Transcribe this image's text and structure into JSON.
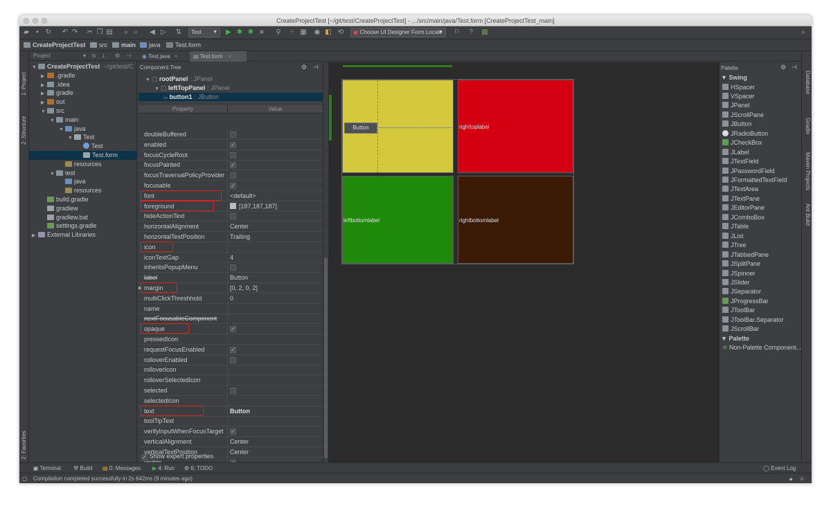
{
  "window": {
    "title": "CreateProjectTest [~/git/test/CreateProjectTest] - .../src/main/java/Test.form [CreateProjectTest_main]"
  },
  "toolbar": {
    "run_config": "Test",
    "locale_combo": "Choose UI Designer Form Locale"
  },
  "navbar": {
    "crumbs": [
      "CreateProjectTest",
      "src",
      "main",
      "java",
      "Test.form"
    ]
  },
  "left_strip": {
    "project": "1: Project",
    "structure": "2: Structure",
    "favorites": "2: Favorites"
  },
  "right_strip": {
    "database": "Database",
    "gradle": "Gradle",
    "maven": "Maven Projects",
    "ant": "Ant Build"
  },
  "project_panel": {
    "header": "Project",
    "items": [
      {
        "label": "CreateProjectTest",
        "suffix": "~/git/test/C",
        "depth": 0,
        "arrow": "▼",
        "icon": "folder-icon"
      },
      {
        "label": ".gradle",
        "depth": 1,
        "arrow": "▶",
        "icon": "folder-icon"
      },
      {
        "label": ".idea",
        "depth": 1,
        "arrow": "▶",
        "icon": "folder-icon"
      },
      {
        "label": "gradle",
        "depth": 1,
        "arrow": "▶",
        "icon": "folder-icon"
      },
      {
        "label": "out",
        "depth": 1,
        "arrow": "▶",
        "icon": "folder-icon"
      },
      {
        "label": "src",
        "depth": 1,
        "arrow": "▼",
        "icon": "folder-icon"
      },
      {
        "label": "main",
        "depth": 2,
        "arrow": "▼",
        "icon": "folder-icon"
      },
      {
        "label": "java",
        "depth": 3,
        "arrow": "▼",
        "icon": "folder-icon"
      },
      {
        "label": "Test",
        "depth": 4,
        "arrow": "▼",
        "icon": "form-icon"
      },
      {
        "label": "Test",
        "depth": 5,
        "arrow": "",
        "icon": "class-icon"
      },
      {
        "label": "Test.form",
        "depth": 5,
        "arrow": "",
        "icon": "form-icon"
      },
      {
        "label": "resources",
        "depth": 3,
        "arrow": "",
        "icon": "folder-icon"
      },
      {
        "label": "test",
        "depth": 2,
        "arrow": "▼",
        "icon": "folder-icon"
      },
      {
        "label": "java",
        "depth": 3,
        "arrow": "",
        "icon": "folder-icon"
      },
      {
        "label": "resources",
        "depth": 3,
        "arrow": "",
        "icon": "folder-icon"
      },
      {
        "label": "build.gradle",
        "depth": 1,
        "arrow": "",
        "icon": "gradle-icon"
      },
      {
        "label": "gradlew",
        "depth": 1,
        "arrow": "",
        "icon": "file-icon"
      },
      {
        "label": "gradlew.bat",
        "depth": 1,
        "arrow": "",
        "icon": "file-icon"
      },
      {
        "label": "settings.gradle",
        "depth": 1,
        "arrow": "",
        "icon": "gradle-icon"
      },
      {
        "label": "External Libraries",
        "depth": 0,
        "arrow": "▶",
        "icon": "library-icon"
      }
    ]
  },
  "editor_tabs": [
    "Test.java",
    "Test.form"
  ],
  "component_tree": {
    "header": "Component Tree",
    "nodes": [
      {
        "name": "rootPanel",
        "type": ": JPanel",
        "depth": 0
      },
      {
        "name": "leftTopPanel",
        "type": ": JPanel",
        "depth": 1
      },
      {
        "name": "button1",
        "type": ": JButton",
        "depth": 2
      }
    ]
  },
  "properties": {
    "header_property": "Property",
    "header_value": "Value",
    "footer_checkbox": "Show expert properties",
    "rows": [
      {
        "name": "doubleBuffered",
        "type": "check",
        "checked": false
      },
      {
        "name": "enabled",
        "type": "check",
        "checked": true
      },
      {
        "name": "focusCycleRoot",
        "type": "check",
        "checked": false
      },
      {
        "name": "focusPainted",
        "type": "check",
        "checked": true
      },
      {
        "name": "focusTraversalPolicyProvider",
        "type": "check",
        "checked": false
      },
      {
        "name": "focusable",
        "type": "check",
        "checked": true
      },
      {
        "name": "font",
        "type": "text",
        "value": "<default>",
        "highlight": true
      },
      {
        "name": "foreground",
        "type": "color",
        "value": "[187,187,187]",
        "highlight": true
      },
      {
        "name": "hideActionText",
        "type": "check",
        "checked": false
      },
      {
        "name": "horizontalAlignment",
        "type": "text",
        "value": "Center"
      },
      {
        "name": "horizontalTextPosition",
        "type": "text",
        "value": "Trailing"
      },
      {
        "name": "icon",
        "type": "text",
        "value": "",
        "highlight": true
      },
      {
        "name": "iconTextGap",
        "type": "text",
        "value": "4"
      },
      {
        "name": "inheritsPopupMenu",
        "type": "check",
        "checked": false
      },
      {
        "name": "label",
        "type": "text",
        "value": "Button",
        "strike": true
      },
      {
        "name": "margin",
        "type": "text",
        "value": "[0, 2, 0, 2]",
        "highlight": true,
        "expand": true
      },
      {
        "name": "multiClickThreshhold",
        "type": "text",
        "value": "0"
      },
      {
        "name": "name",
        "type": "text",
        "value": ""
      },
      {
        "name": "nextFocusableComponent",
        "type": "text",
        "value": "",
        "strike": true
      },
      {
        "name": "opaque",
        "type": "check",
        "checked": true,
        "highlight": true
      },
      {
        "name": "pressedIcon",
        "type": "text",
        "value": ""
      },
      {
        "name": "requestFocusEnabled",
        "type": "check",
        "checked": true
      },
      {
        "name": "rolloverEnabled",
        "type": "check",
        "checked": false
      },
      {
        "name": "rolloverIcon",
        "type": "text",
        "value": ""
      },
      {
        "name": "rolloverSelectedIcon",
        "type": "text",
        "value": ""
      },
      {
        "name": "selected",
        "type": "check",
        "checked": false
      },
      {
        "name": "selectedIcon",
        "type": "text",
        "value": ""
      },
      {
        "name": "text",
        "type": "text",
        "value": "Button",
        "highlight": true,
        "bold": true
      },
      {
        "name": "toolTipText",
        "type": "text",
        "value": ""
      },
      {
        "name": "verifyInputWhenFocusTarget",
        "type": "check",
        "checked": true
      },
      {
        "name": "verticalAlignment",
        "type": "text",
        "value": "Center"
      },
      {
        "name": "verticalTextPosition",
        "type": "text",
        "value": "Center"
      },
      {
        "name": "visible",
        "type": "check",
        "checked": true
      }
    ]
  },
  "designer": {
    "button_label": "Button",
    "righttop_label": "righttoplabel",
    "leftbottom_label": "leftbottomlabel",
    "rightbottom_label": "rightbottomlabel",
    "colors": {
      "lefttop": "#d4c93c",
      "righttop": "#d40012",
      "leftbottom": "#1f8a0a",
      "rightbottom": "#3a1a05"
    }
  },
  "palette": {
    "header": "Palette",
    "group_swing": "Swing",
    "group_palette": "Palette",
    "swing_items": [
      "HSpacer",
      "VSpacer",
      "JPanel",
      "JScrollPane",
      "JButton",
      "JRadioButton",
      "JCheckBox",
      "JLabel",
      "JTextField",
      "JPasswordField",
      "JFormattedTextField",
      "JTextArea",
      "JTextPane",
      "JEditorPane",
      "JComboBox",
      "JTable",
      "JList",
      "JTree",
      "JTabbedPane",
      "JSplitPane",
      "JSpinner",
      "JSlider",
      "JSeparator",
      "JProgressBar",
      "JToolBar",
      "JToolBar.Separator",
      "JScrollBar"
    ],
    "palette_items": [
      "Non-Palette Component..."
    ]
  },
  "bottom_bar": {
    "terminal": "Terminal",
    "build": "Build",
    "messages": "0: Messages",
    "run": "4: Run",
    "todo": "6: TODO",
    "event_log": "Event Log"
  },
  "status": {
    "message": "Compilation completed successfully in 2s 642ms (9 minutes ago)"
  }
}
